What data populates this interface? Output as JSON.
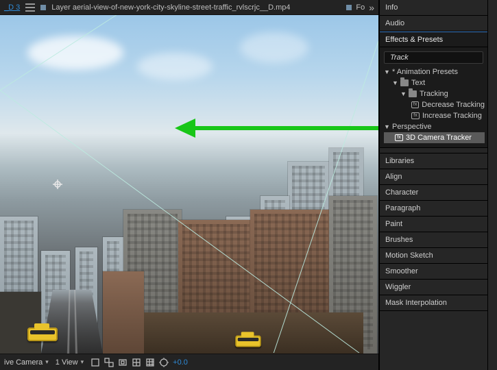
{
  "tabbar": {
    "left_link": "_D 3",
    "layer_label": "Layer aerial-view-of-new-york-city-skyline-street-traffic_rvlscrjc__D.mp4",
    "right_label": "Fo"
  },
  "bottombar": {
    "camera_label": "ive Camera",
    "view_label": "1 View",
    "exposure": "+0.0"
  },
  "side": {
    "info": "Info",
    "audio": "Audio",
    "effects": "Effects & Presets",
    "search_value": "Track",
    "tree": {
      "root": "* Animation Presets",
      "text": "Text",
      "tracking": "Tracking",
      "dec": "Decrease Tracking",
      "inc": "Increase Tracking",
      "persp": "Perspective",
      "cam3d": "3D Camera Tracker"
    },
    "panels": {
      "libraries": "Libraries",
      "align": "Align",
      "character": "Character",
      "paragraph": "Paragraph",
      "paint": "Paint",
      "brushes": "Brushes",
      "motion_sketch": "Motion Sketch",
      "smoother": "Smoother",
      "wiggler": "Wiggler",
      "mask_interp": "Mask Interpolation"
    }
  }
}
